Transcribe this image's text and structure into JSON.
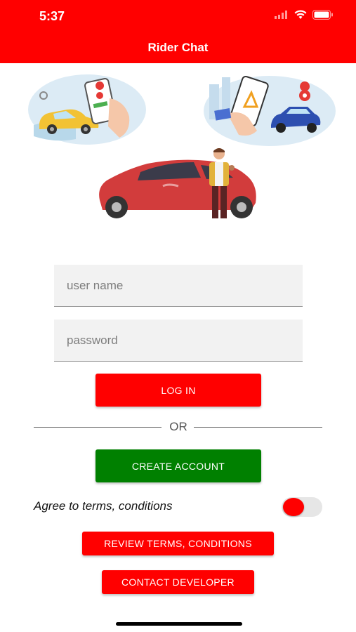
{
  "status_bar": {
    "time": "5:37",
    "icons": [
      "signal-icon",
      "wifi-icon",
      "battery-icon"
    ]
  },
  "header": {
    "title": "Rider Chat",
    "color": "#ff0000"
  },
  "login_form": {
    "username_placeholder": "user name",
    "password_placeholder": "password",
    "login_label": "LOG IN",
    "divider_text": "OR",
    "create_account_label": "CREATE ACCOUNT"
  },
  "terms": {
    "agree_label": "Agree to terms, conditions",
    "toggle_on": true,
    "review_label": "REVIEW TERMS, CONDITIONS",
    "contact_label": "CONTACT DEVELOPER"
  },
  "colors": {
    "primary": "#ff0000",
    "secondary": "#008000",
    "field_bg": "#f2f2f2"
  }
}
